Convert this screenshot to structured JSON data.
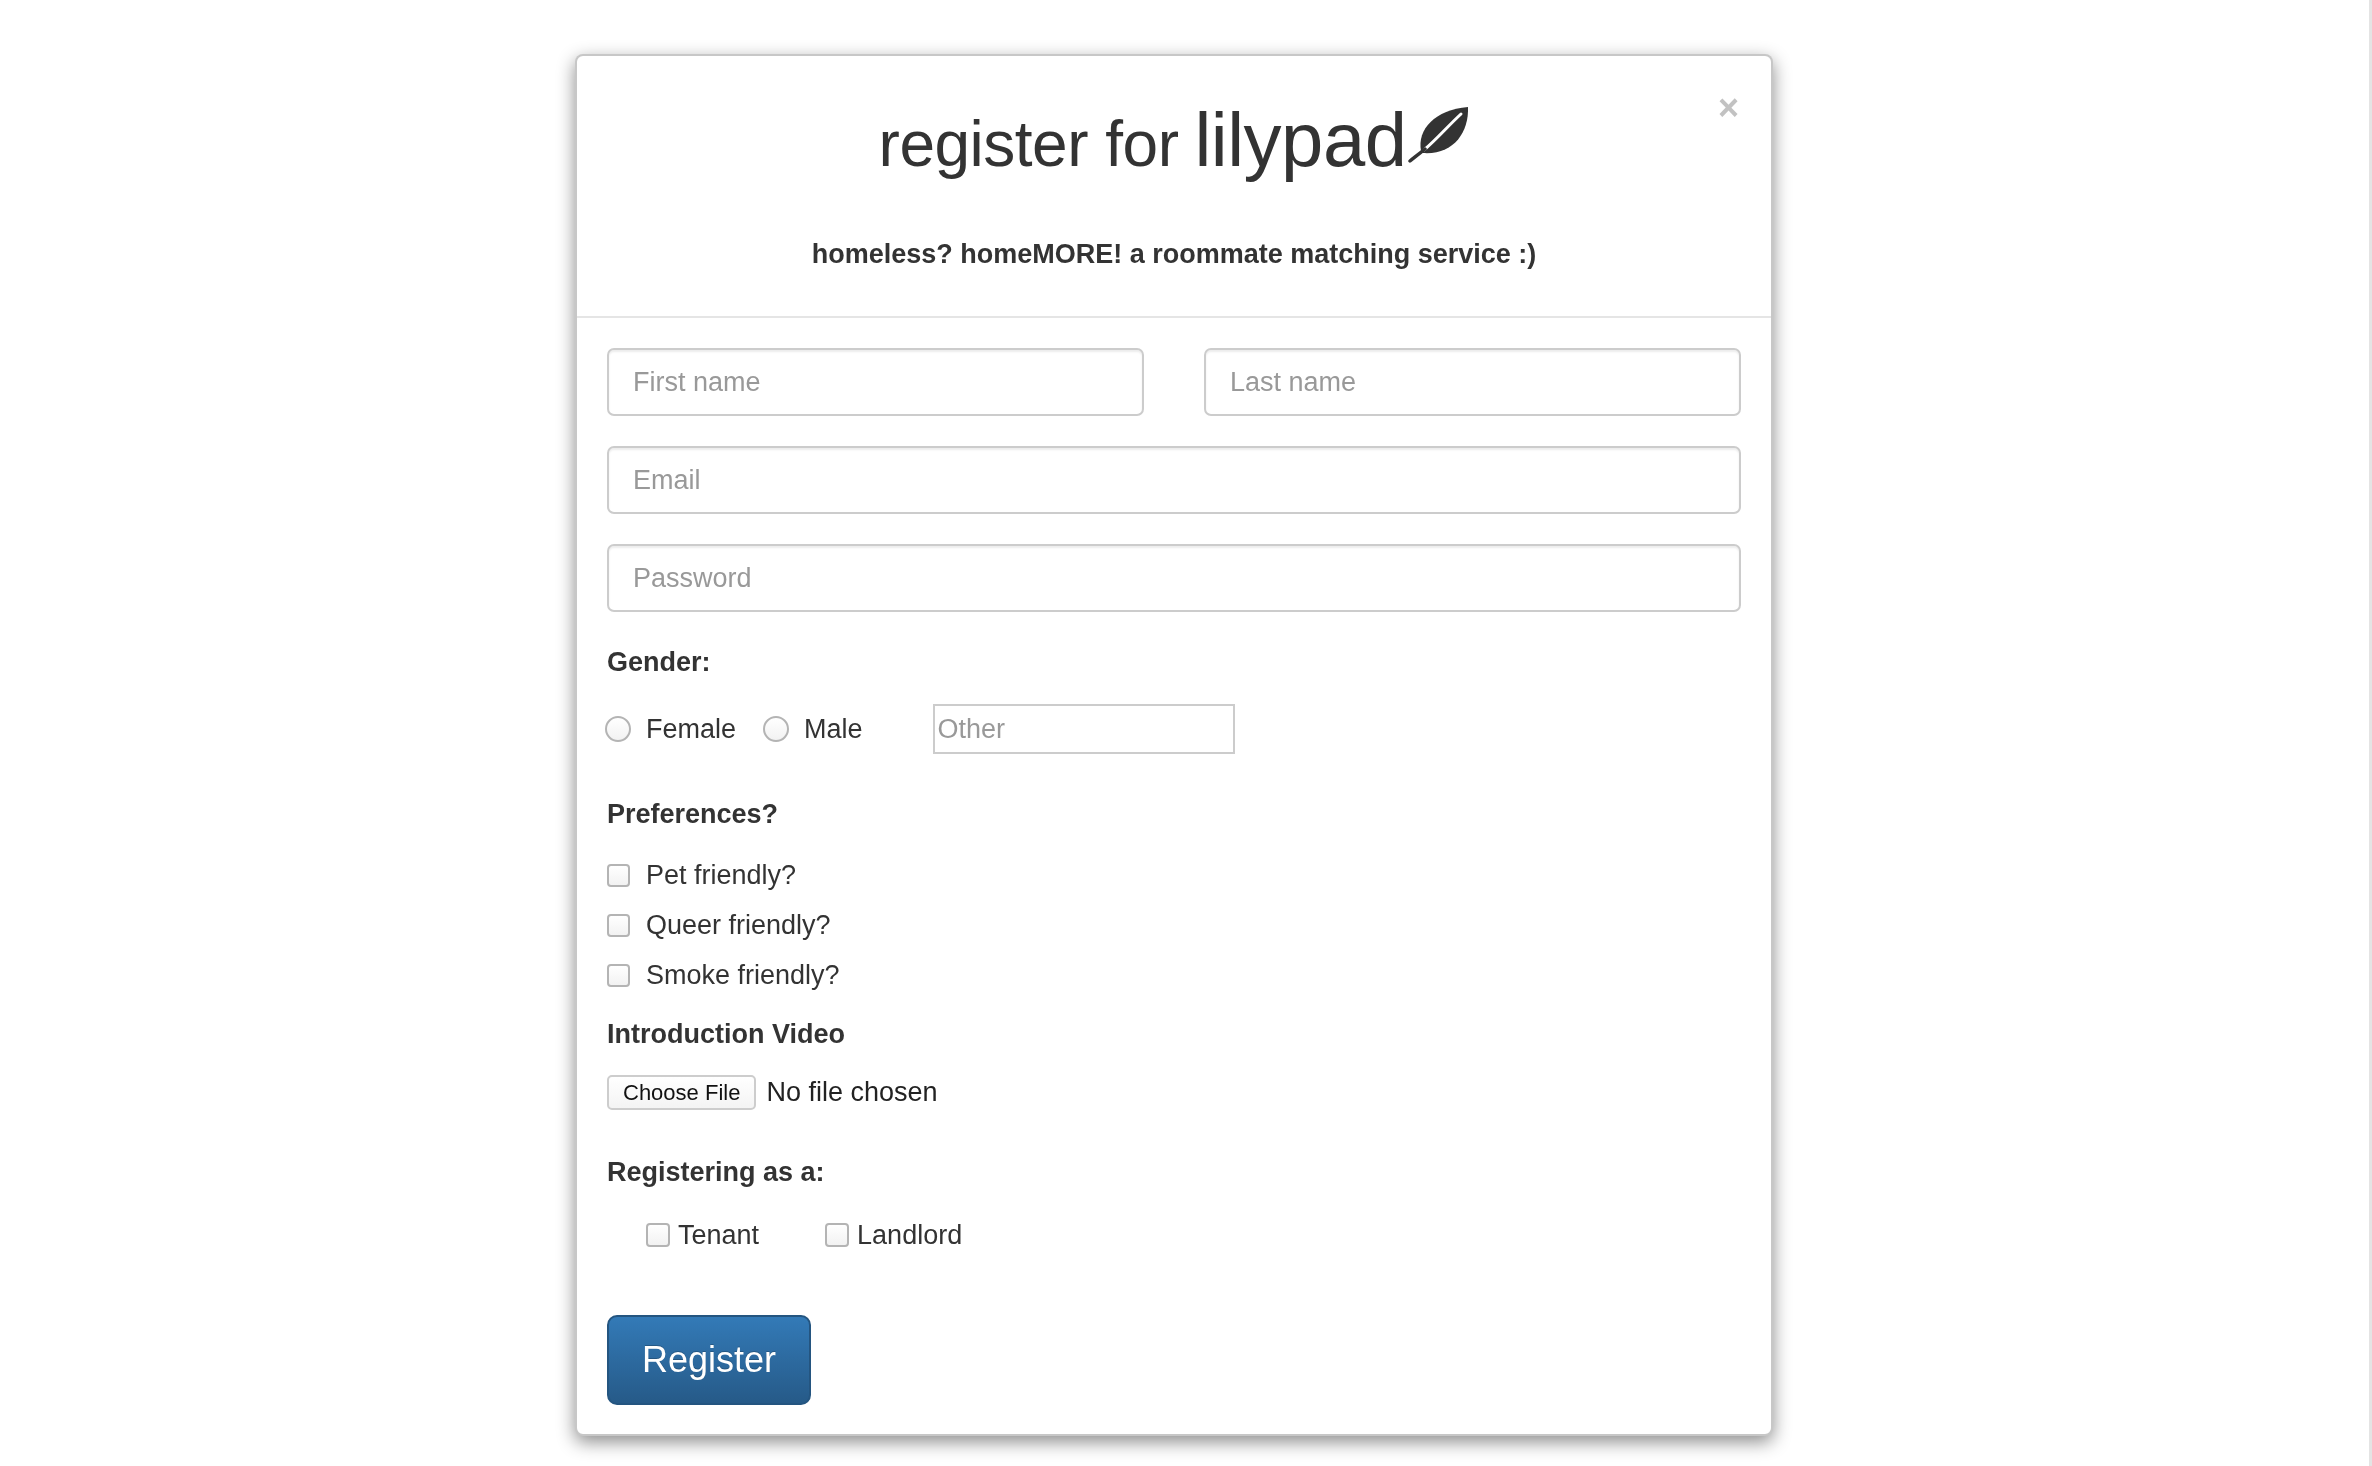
{
  "modal": {
    "title": "register for",
    "brand": "lilypad",
    "close": "×",
    "tagline": "homeless? homeMORE! a roommate matching service :)"
  },
  "form": {
    "name_fields": [
      {
        "placeholder": "First name"
      },
      {
        "placeholder": "Last name"
      }
    ],
    "email": {
      "placeholder": "Email"
    },
    "password": {
      "placeholder": "Password"
    },
    "gender": {
      "label": "Gender:",
      "options": [
        {
          "label": "Female",
          "selected": false
        },
        {
          "label": "Male",
          "selected": false
        }
      ],
      "other": {
        "placeholder": "Other"
      }
    },
    "preferences": {
      "label": "Preferences?",
      "options": [
        {
          "label": "Pet friendly?",
          "checked": false
        },
        {
          "label": "Queer friendly?",
          "checked": false
        },
        {
          "label": "Smoke friendly?",
          "checked": false
        }
      ]
    },
    "video": {
      "label": "Introduction Video",
      "button": "Choose File",
      "status": "No file chosen"
    },
    "role": {
      "label": "Registering as a:",
      "options": [
        {
          "label": "Tenant",
          "checked": false
        },
        {
          "label": "Landlord",
          "checked": false
        }
      ]
    },
    "submit": "Register"
  }
}
